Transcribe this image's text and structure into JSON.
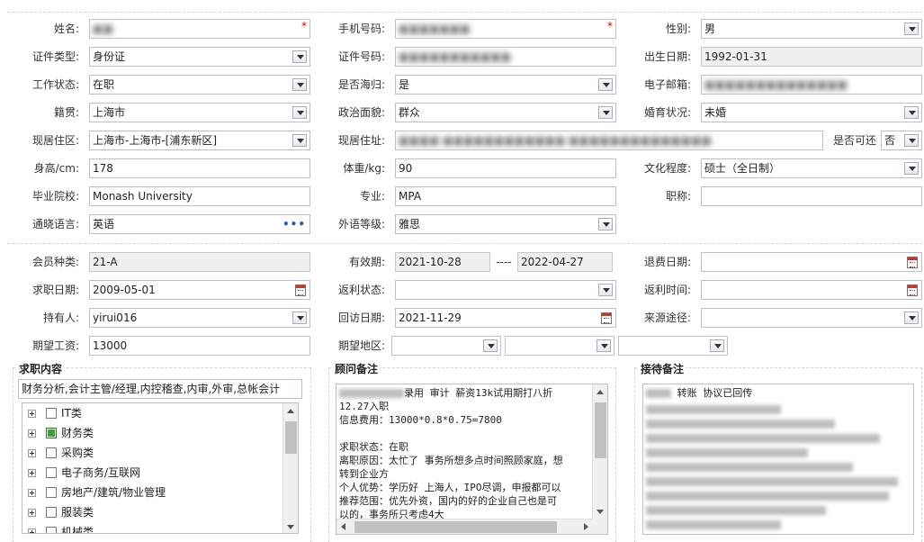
{
  "personal": {
    "name": {
      "label": "姓名:",
      "value": "■■"
    },
    "mobile": {
      "label": "手机号码:",
      "value": "■■■■■■■"
    },
    "gender": {
      "label": "性别:",
      "value": "男"
    },
    "id_type": {
      "label": "证件类型:",
      "value": "身份证"
    },
    "id_number": {
      "label": "证件号码:",
      "value": "■■■■■■■■■■■"
    },
    "birthdate": {
      "label": "出生日期:",
      "value": "1992-01-31"
    },
    "work_status": {
      "label": "工作状态:",
      "value": "在职"
    },
    "returnee": {
      "label": "是否海归:",
      "value": "是"
    },
    "email": {
      "label": "电子邮箱:",
      "value": "■■■■■■■■■■■■■■"
    },
    "native_place": {
      "label": "籍贯:",
      "value": "上海市"
    },
    "political": {
      "label": "政治面貌:",
      "value": "群众"
    },
    "marital": {
      "label": "婚育状况:",
      "value": "未婚"
    },
    "residence_area": {
      "label": "现居住区:",
      "value": "上海市-上海市-[浦东新区]"
    },
    "address": {
      "label": "现居住址:",
      "value": "■■■■ ■■■■■■■■■■■■ ■■■■■■■■■■■■■■"
    },
    "visitable": {
      "label": "是否可还",
      "value": "否"
    },
    "height": {
      "label": "身高/cm:",
      "value": "178"
    },
    "weight": {
      "label": "体重/kg:",
      "value": "90"
    },
    "education": {
      "label": "文化程度:",
      "value": "硕士（全日制）"
    },
    "school": {
      "label": "毕业院校:",
      "value": "Monash University"
    },
    "major": {
      "label": "专业:",
      "value": "MPA"
    },
    "title": {
      "label": "职称:",
      "value": ""
    },
    "language": {
      "label": "通晓语言:",
      "value": "英语"
    },
    "foreign_level": {
      "label": "外语等级:",
      "value": "雅思"
    }
  },
  "membership": {
    "member_type": {
      "label": "会员种类:",
      "value": "21-A"
    },
    "validity": {
      "label": "有效期:",
      "from": "2021-10-28",
      "sep": "----",
      "to": "2022-04-27"
    },
    "refund_date": {
      "label": "退费日期:",
      "value": ""
    },
    "job_search_date": {
      "label": "求职日期:",
      "value": "2009-05-01"
    },
    "rebate_status": {
      "label": "返利状态:",
      "value": ""
    },
    "rebate_time": {
      "label": "返利时间:",
      "value": ""
    },
    "holder": {
      "label": "持有人:",
      "value": "yirui016"
    },
    "visit_date": {
      "label": "回访日期:",
      "value": "2021-11-29"
    },
    "source": {
      "label": "来源途径:",
      "value": ""
    },
    "expected_salary": {
      "label": "期望工资:",
      "value": "13000"
    },
    "expected_region": {
      "label": "期望地区:",
      "values": [
        "",
        "",
        ""
      ]
    }
  },
  "job_content": {
    "title": "求职内容",
    "summary": "财务分析,会计主管/经理,内控稽查,内审,外审,总帐会计",
    "categories": [
      {
        "label": "IT类",
        "checked": false
      },
      {
        "label": "财务类",
        "checked": true
      },
      {
        "label": "采购类",
        "checked": false
      },
      {
        "label": "电子商务/互联网",
        "checked": false
      },
      {
        "label": "房地产/建筑/物业管理",
        "checked": false
      },
      {
        "label": "服装类",
        "checked": false
      },
      {
        "label": "机械类",
        "checked": false
      }
    ]
  },
  "advisor_notes": {
    "title": "顾问备注",
    "line1_suffix": "录用 审计 薪资13k试用期打八折",
    "lines": [
      "12.27入职",
      "信息费用：13000*0.8*0.75=7800",
      "",
      "求职状态：在职",
      "离职原因：太忙了 事务所想多点时间照顾家庭，想",
      "转到企业方",
      "个人优势：学历好  上海人，IPO尽调，申报都可以",
      "推荐范围：优先外资，国内的好的企业自己也是可",
      "以的，事务所只考虑4大"
    ]
  },
  "reception_notes": {
    "title": "接待备注",
    "line1": "转账   协议已回传"
  }
}
